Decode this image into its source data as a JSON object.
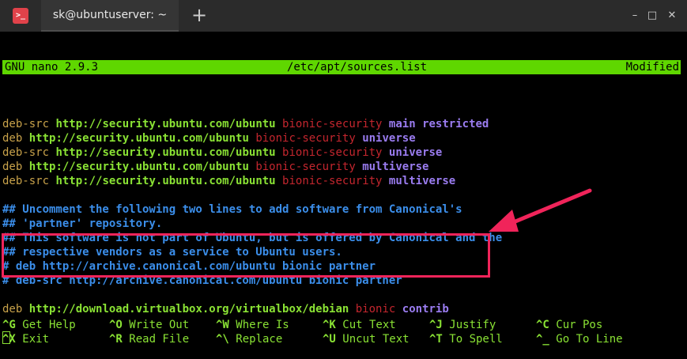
{
  "window": {
    "tab_title": "sk@ubuntuserver: ~",
    "new_tab_symbol": "+",
    "logo_text": ">_",
    "controls": {
      "minimize": "–",
      "maximize": "□",
      "close": "✕"
    }
  },
  "nano": {
    "version": "GNU nano 2.9.3",
    "file": "/etc/apt/sources.list",
    "status": "Modified"
  },
  "lines": [
    {
      "kind": "blank"
    },
    {
      "kind": "source",
      "type": "deb-src",
      "url": "http://security.ubuntu.com/ubuntu",
      "dist": "bionic-security",
      "components": "main restricted"
    },
    {
      "kind": "source",
      "type": "deb",
      "url": "http://security.ubuntu.com/ubuntu",
      "dist": "bionic-security",
      "components": "universe"
    },
    {
      "kind": "source",
      "type": "deb-src",
      "url": "http://security.ubuntu.com/ubuntu",
      "dist": "bionic-security",
      "components": "universe"
    },
    {
      "kind": "source",
      "type": "deb",
      "url": "http://security.ubuntu.com/ubuntu",
      "dist": "bionic-security",
      "components": "multiverse"
    },
    {
      "kind": "source",
      "type": "deb-src",
      "url": "http://security.ubuntu.com/ubuntu",
      "dist": "bionic-security",
      "components": "multiverse"
    },
    {
      "kind": "blank"
    },
    {
      "kind": "comment",
      "text": "## Uncomment the following two lines to add software from Canonical's"
    },
    {
      "kind": "comment",
      "text": "## 'partner' repository."
    },
    {
      "kind": "comment",
      "text": "## This software is not part of Ubuntu, but is offered by Canonical and the"
    },
    {
      "kind": "comment",
      "text": "## respective vendors as a service to Ubuntu users."
    },
    {
      "kind": "comment",
      "text": "# deb http://archive.canonical.com/ubuntu bionic partner"
    },
    {
      "kind": "comment",
      "text": "# deb-src http://archive.canonical.com/ubuntu bionic partner"
    },
    {
      "kind": "blank"
    },
    {
      "kind": "source",
      "type": "deb",
      "url": "http://download.virtualbox.org/virtualbox/debian",
      "dist": "bionic",
      "components": "contrib"
    },
    {
      "kind": "blank"
    },
    {
      "kind": "cursor"
    }
  ],
  "shortcuts": [
    {
      "key": "^G",
      "label": "Get Help"
    },
    {
      "key": "^O",
      "label": "Write Out"
    },
    {
      "key": "^W",
      "label": "Where Is"
    },
    {
      "key": "^K",
      "label": "Cut Text"
    },
    {
      "key": "^J",
      "label": "Justify"
    },
    {
      "key": "^C",
      "label": "Cur Pos"
    },
    {
      "key": "^X",
      "label": "Exit"
    },
    {
      "key": "^R",
      "label": "Read File"
    },
    {
      "key": "^\\",
      "label": "Replace"
    },
    {
      "key": "^U",
      "label": "Uncut Text"
    },
    {
      "key": "^T",
      "label": "To Spell"
    },
    {
      "key": "^_",
      "label": "Go To Line"
    }
  ],
  "colors": {
    "header_bg": "#5fd700",
    "url": "#8ae234",
    "type": "#c8a24a",
    "dist": "#c4262e",
    "components": "#9a7cf0",
    "comment": "#3b8eea",
    "annotation": "#f0245a"
  }
}
